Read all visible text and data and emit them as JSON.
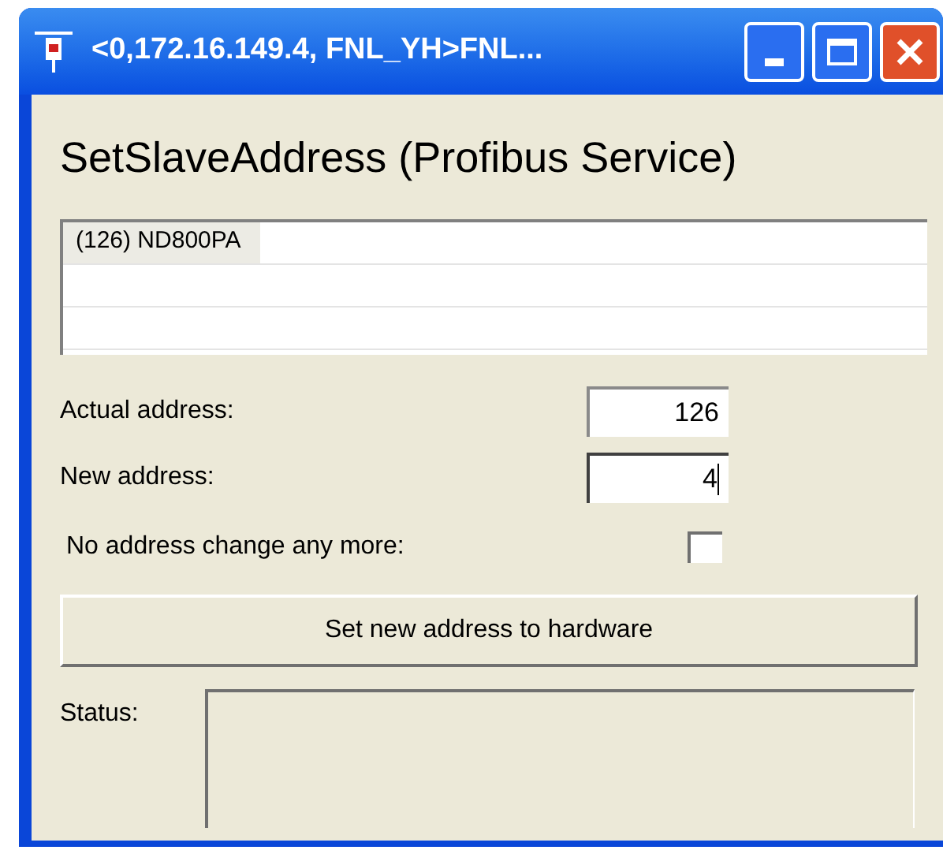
{
  "window": {
    "title": "<0,172.16.149.4, FNL_YH>FNL..."
  },
  "heading": "SetSlaveAddress (Profibus Service)",
  "device_list": [
    {
      "text": "(126) ND800PA",
      "selected": true
    }
  ],
  "fields": [
    {
      "label": "Actual address:",
      "value": "126",
      "focused": false
    },
    {
      "label": "New address:",
      "value": "4",
      "focused": true
    }
  ],
  "lock_option": {
    "label": "No address change any more:",
    "checked": false
  },
  "set_button": "Set new address to hardware",
  "status": {
    "label": "Status:"
  }
}
